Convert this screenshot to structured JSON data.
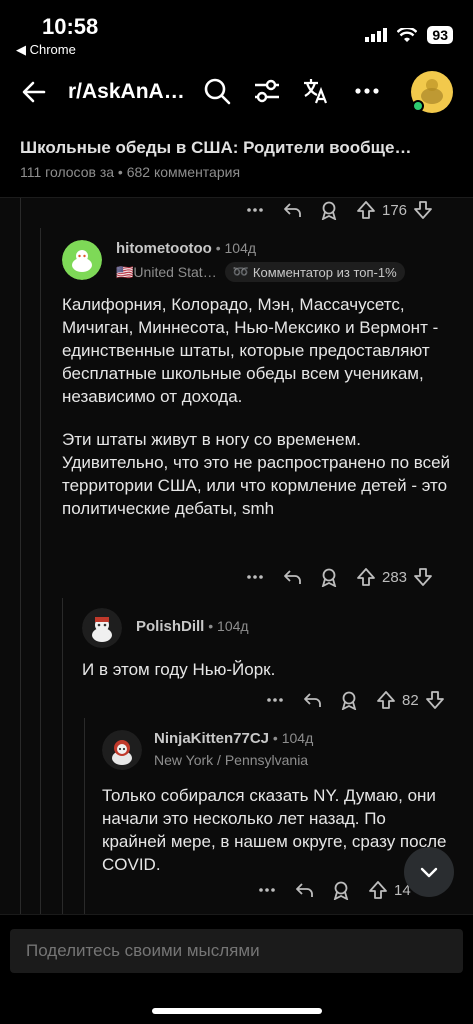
{
  "status_bar": {
    "time": "10:58",
    "back_app": "◀ Chrome",
    "battery": "93"
  },
  "header": {
    "subreddit": "r/AskAnA…"
  },
  "post": {
    "title": "Школьные обеды в США: Родители вообще…",
    "meta": "111 голосов за • 682 комментария"
  },
  "top_actions": {
    "votes": "176"
  },
  "comments": [
    {
      "username": "hitometootoo",
      "age": "104д",
      "location": "🇺🇸United Stat…",
      "flair": "Комментатор из топ-1%",
      "paragraphs": [
        "Калифорния, Колорадо, Мэн, Массачусетс, Мичиган, Миннесота, Нью-Мексико и Вермонт - единственные штаты, которые предоставляют бесплатные школьные обеды всем ученикам, независимо от дохода.",
        "Эти штаты живут в ногу со временем. Удивительно, что это не распространено по всей территории США, или что кормление детей - это политические дебаты, smh"
      ],
      "votes": "283"
    },
    {
      "username": "PolishDill",
      "age": "104д",
      "text": "И в этом году Нью-Йорк.",
      "votes": "82"
    },
    {
      "username": "NinjaKitten77CJ",
      "age": "104д",
      "location": "New York / Pennsylvania",
      "text": "Только собирался сказать NY. Думаю, они начали это несколько лет назад. По крайней мере, в нашем округе, сразу после COVID.",
      "votes": "14"
    }
  ],
  "composer": {
    "placeholder": "Поделитесь своими мыслями"
  }
}
